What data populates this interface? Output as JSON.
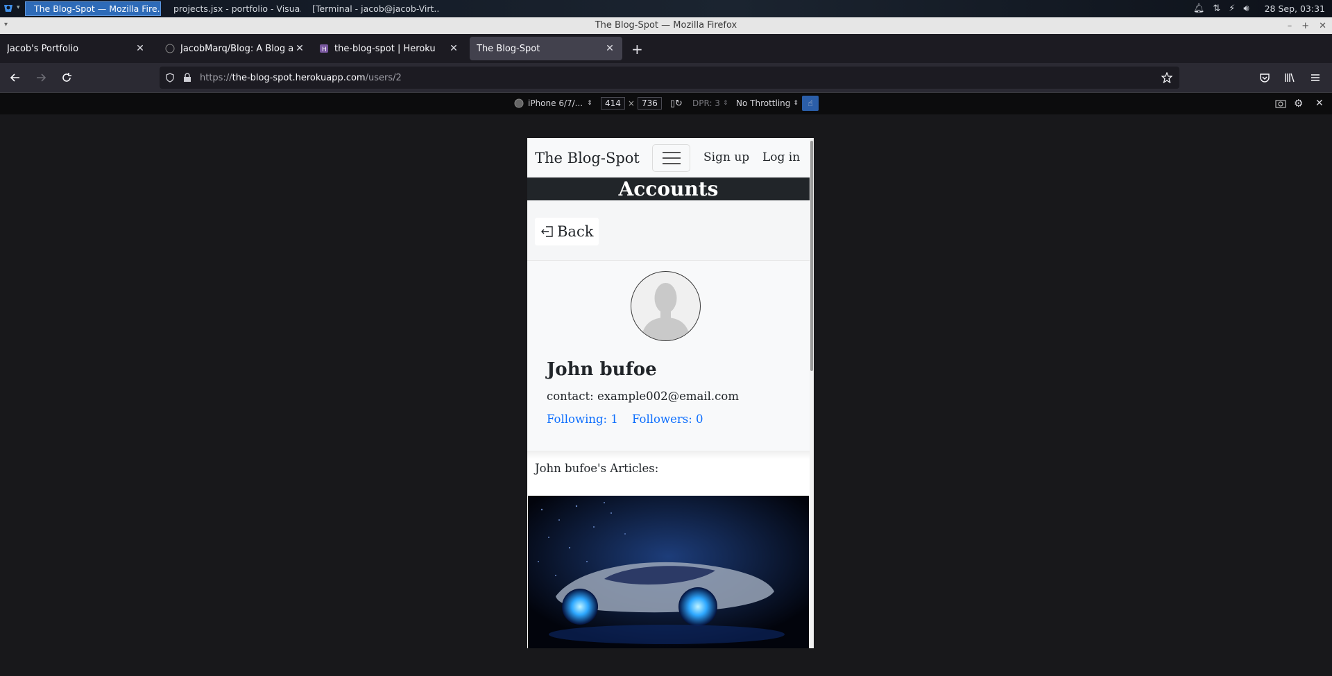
{
  "taskbar": {
    "tasks": [
      {
        "label": "The Blog-Spot — Mozilla Fire...",
        "icon": "firefox-icon",
        "active": true
      },
      {
        "label": "projects.jsx - portfolio - Visua...",
        "icon": "vscode-icon",
        "active": false
      },
      {
        "label": "[Terminal - jacob@jacob-Virt...",
        "icon": "terminal-icon",
        "active": false
      }
    ],
    "clock": "28 Sep, 03:31"
  },
  "window": {
    "title": "The Blog-Spot — Mozilla Firefox"
  },
  "browser": {
    "tabs": [
      {
        "label": "Jacob's Portfolio"
      },
      {
        "label": "JacobMarq/Blog: A Blog app o"
      },
      {
        "label": "the-blog-spot | Heroku"
      },
      {
        "label": "The Blog-Spot"
      }
    ],
    "url": {
      "scheme": "https://",
      "host": "the-blog-spot.herokuapp.com",
      "path": "/users/2"
    }
  },
  "responsive": {
    "device": "iPhone 6/7/...",
    "width": "414",
    "times": "×",
    "height": "736",
    "dpr": "DPR: 3",
    "throttling": "No Throttling"
  },
  "site": {
    "brand": "The Blog-Spot",
    "signup": "Sign up",
    "login": "Log in",
    "header": "Accounts",
    "back": "Back",
    "user": {
      "name": "John bufoe",
      "contact": "contact: example002@email.com",
      "following": "Following: 1",
      "followers": "Followers: 0"
    },
    "articles_heading": "John bufoe's Articles:"
  },
  "colors": {
    "link": "#0d6efd",
    "accounts_bar": "#212529",
    "selected_task": "#2e6bb8"
  }
}
